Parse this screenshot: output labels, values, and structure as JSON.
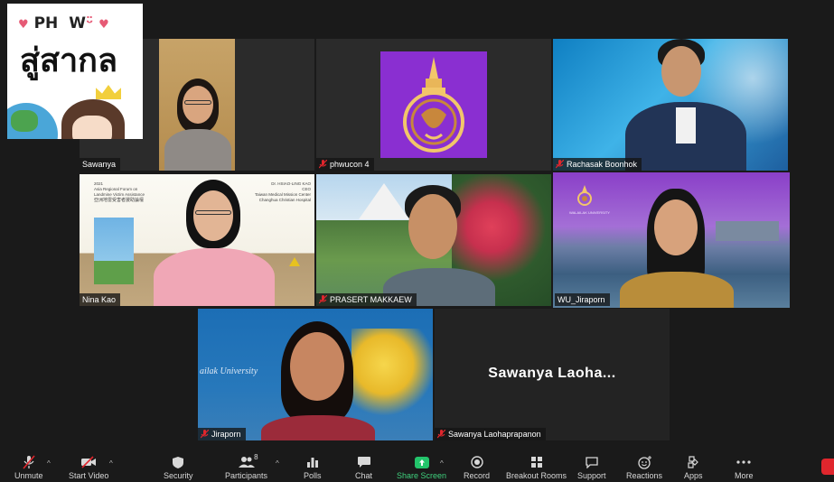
{
  "overlay": {
    "line1_left": "PH",
    "line1_right": "W",
    "line1_smile": "ᵕ̈",
    "line2": "สู่สากล"
  },
  "tiles": [
    {
      "name": "Sawanya"
    },
    {
      "name": "phwucon 4"
    },
    {
      "name": "Rachasak Boonhok"
    },
    {
      "name": "Nina Kao"
    },
    {
      "name": "PRASERT MAKKAEW"
    },
    {
      "name": "WU_Jiraporn"
    },
    {
      "name": "Jiraporn"
    },
    {
      "name": "Sawanya Laohaprapanon",
      "display": "Sawanya  Laoha..."
    }
  ],
  "slide": {
    "year": "2021",
    "event_line1": "Asia Regional Forum on",
    "event_line2": "Landmine Victim Assistance",
    "event_cjk": "亞洲地雷受害者援助論壇",
    "speaker": "Dr. HSIAO-LING KAO",
    "speaker_role": "CEO",
    "org_line1": "Taiwan Medical Mission Center",
    "org_line2": "Changhua Christian Hospital"
  },
  "background_text": {
    "wu_tile": "WALAILAK UNIVERSITY",
    "jiraporn_tile": "ailak University"
  },
  "toolbar": {
    "unmute": "Unmute",
    "start_video": "Start Video",
    "security": "Security",
    "participants": "Participants",
    "participants_count": "8",
    "polls": "Polls",
    "chat": "Chat",
    "share_screen": "Share Screen",
    "record": "Record",
    "breakout_rooms": "Breakout Rooms",
    "support": "Support",
    "reactions": "Reactions",
    "apps": "Apps",
    "more": "More"
  },
  "colors": {
    "active_speaker": "#d8e27a",
    "share_green": "#23c46b",
    "mic_off_red": "#e0262d",
    "wu_purple": "#8a2fd1"
  }
}
